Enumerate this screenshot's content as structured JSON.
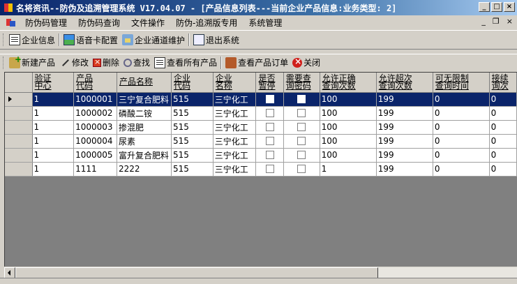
{
  "window": {
    "title": "名将资讯--防伪及追溯管理系统 V17.04.07 - [产品信息列表---当前企业产品信息:业务类型: 2]",
    "min": "_",
    "max": "□",
    "close": "×"
  },
  "menu": {
    "items": [
      "防伪码管理",
      "防伪码查询",
      "文件操作",
      "防伪-追溯版专用",
      "系统管理"
    ],
    "mdi_min": "_",
    "mdi_restore": "❐",
    "mdi_close": "×"
  },
  "toolbar_top": {
    "company_info": "企业信息",
    "voice_card": "语音卡配置",
    "channel_maint": "企业通道维护",
    "exit": "退出系统"
  },
  "toolbar_grid": {
    "new_product": "新建产品",
    "edit": "修改",
    "delete": "删除",
    "find": "查找",
    "view_all": "查看所有产品",
    "view_orders": "查看产品订单",
    "close": "关闭"
  },
  "grid": {
    "columns": [
      [
        "验证",
        "中心"
      ],
      [
        "产品",
        "代码"
      ],
      [
        "产品名称"
      ],
      [
        "企业",
        "代码"
      ],
      [
        "企业",
        "名称"
      ],
      [
        "是否",
        "暂停"
      ],
      [
        "需要查",
        "询密码"
      ],
      [
        "允许正确",
        "查询次数"
      ],
      [
        "允许超次",
        "查询次数"
      ],
      [
        "可无限制",
        "查询时间"
      ],
      [
        "接续",
        "询次"
      ]
    ],
    "rows": [
      {
        "center": "1",
        "code": "1000001",
        "name": "三宁复合肥料",
        "corp_code": "515",
        "corp_name": "三宁化工",
        "paused": false,
        "need_pwd": false,
        "allow_ok": "100",
        "allow_over": "199",
        "unlimited": "0",
        "cont": "0"
      },
      {
        "center": "1",
        "code": "1000002",
        "name": "磷酸二铵",
        "corp_code": "515",
        "corp_name": "三宁化工",
        "paused": false,
        "need_pwd": false,
        "allow_ok": "100",
        "allow_over": "199",
        "unlimited": "0",
        "cont": "0"
      },
      {
        "center": "1",
        "code": "1000003",
        "name": "掺混肥",
        "corp_code": "515",
        "corp_name": "三宁化工",
        "paused": false,
        "need_pwd": false,
        "allow_ok": "100",
        "allow_over": "199",
        "unlimited": "0",
        "cont": "0"
      },
      {
        "center": "1",
        "code": "1000004",
        "name": "尿素",
        "corp_code": "515",
        "corp_name": "三宁化工",
        "paused": false,
        "need_pwd": false,
        "allow_ok": "100",
        "allow_over": "199",
        "unlimited": "0",
        "cont": "0"
      },
      {
        "center": "1",
        "code": "1000005",
        "name": "富升复合肥料",
        "corp_code": "515",
        "corp_name": "三宁化工",
        "paused": false,
        "need_pwd": false,
        "allow_ok": "100",
        "allow_over": "199",
        "unlimited": "0",
        "cont": "0"
      },
      {
        "center": "1",
        "code": "1111",
        "name": "2222",
        "corp_code": "515",
        "corp_name": "三宁化工",
        "paused": false,
        "need_pwd": false,
        "allow_ok": "1",
        "allow_over": "199",
        "unlimited": "0",
        "cont": "0"
      }
    ],
    "selected_row": 0
  }
}
